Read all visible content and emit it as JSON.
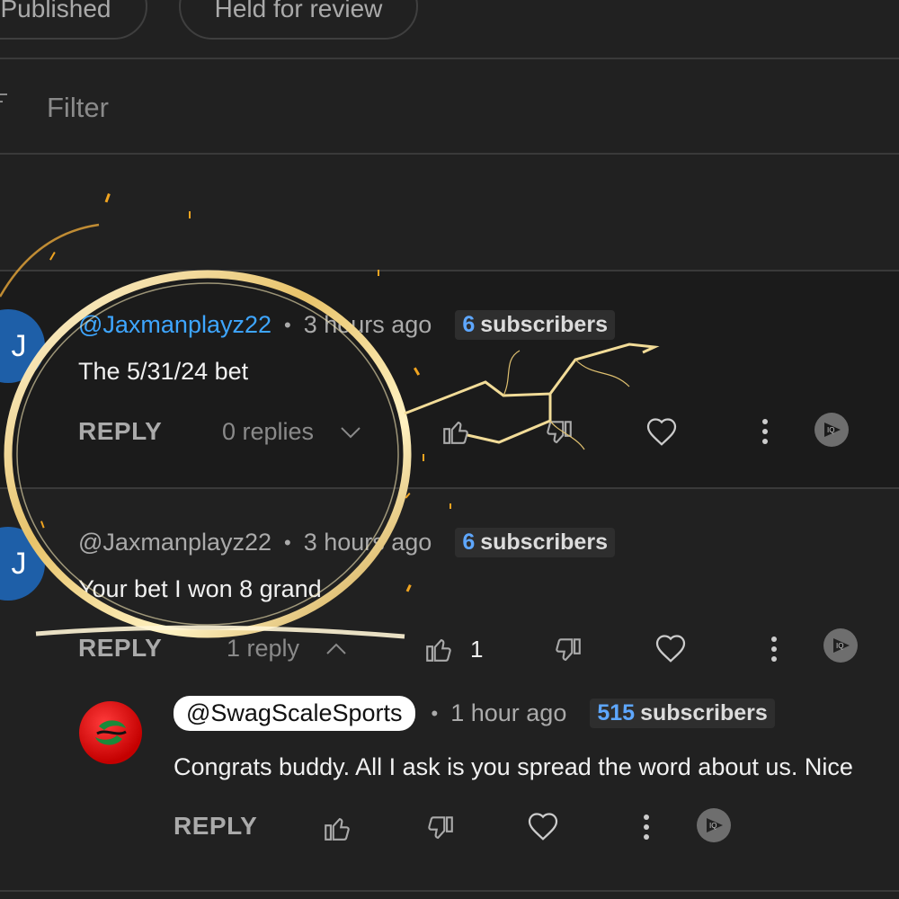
{
  "tabs": [
    {
      "label": "Published"
    },
    {
      "label": "Held for review"
    }
  ],
  "filter": {
    "label": "Filter"
  },
  "comments": [
    {
      "avatar_letter": "J",
      "handle": "@Jaxmanplayz22",
      "time": "3 hours ago",
      "subscribers_count": "6",
      "subscribers_label": "subscribers",
      "text": "The 5/31/24 bet",
      "reply_label": "REPLY",
      "replies_label": "0 replies"
    },
    {
      "avatar_letter": "J",
      "handle": "@Jaxmanplayz22",
      "time": "3 hours ago",
      "subscribers_count": "6",
      "subscribers_label": "subscribers",
      "text": "Your bet I won 8 grand",
      "reply_label": "REPLY",
      "replies_label": "1 reply",
      "like_count": "1"
    }
  ],
  "reply": {
    "handle": "@SwagScaleSports",
    "time": "1 hour ago",
    "subscribers_count": "515",
    "subscribers_label": "subscribers",
    "text": "Congrats buddy. All I ask is you spread the word about us. Nice",
    "reply_label": "REPLY"
  },
  "colors": {
    "background": "#212121",
    "accent_blue": "#3ea6ff",
    "avatar_blue": "#1e5fa8"
  }
}
